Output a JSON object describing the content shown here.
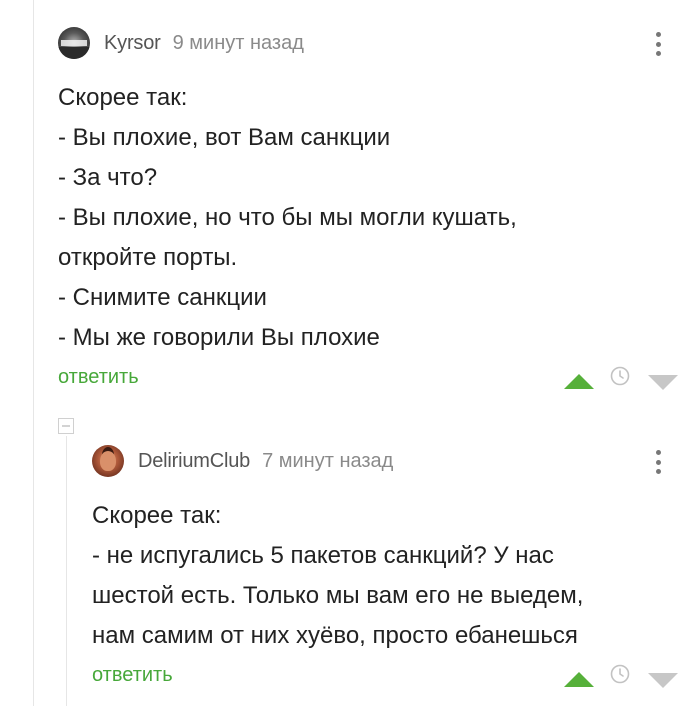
{
  "comments": [
    {
      "username": "Kyrsor",
      "timestamp": "9 минут назад",
      "lines": [
        "Скорее так:",
        "- Вы плохие, вот Вам санкции",
        "- За что?",
        "- Вы плохие, но что бы мы могли кушать,",
        "откройте порты.",
        "- Снимите санкции",
        "- Мы же говорили Вы плохие"
      ],
      "reply_label": "ответить",
      "icons": {
        "more": "more-vertical-icon",
        "up": "vote-up-icon",
        "save": "clock-icon",
        "down": "vote-down-icon"
      }
    },
    {
      "username": "DeliriumClub",
      "timestamp": "7 минут назад",
      "lines": [
        "Скорее так:",
        "- не испугались 5 пакетов санкций? У нас",
        "шестой есть. Только мы вам его не выедем,",
        "нам самим от них хуёво, просто ебанешься"
      ],
      "reply_label": "ответить",
      "icons": {
        "more": "more-vertical-icon",
        "up": "vote-up-icon",
        "save": "clock-icon",
        "down": "vote-down-icon"
      }
    }
  ],
  "colors": {
    "accent_green": "#47a83a",
    "vote_up": "#56b03a",
    "vote_down": "#c7c7c7",
    "muted": "#8a8a8a"
  }
}
